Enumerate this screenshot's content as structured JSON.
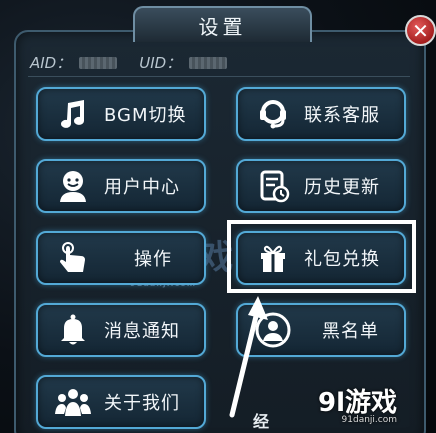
{
  "dialog": {
    "title": "设置",
    "close_glyph": "✕"
  },
  "ids": {
    "aid_label": "AID：",
    "uid_label": "UID："
  },
  "buttons": [
    {
      "label": "BGM切换",
      "icon": "music-note-icon"
    },
    {
      "label": "联系客服",
      "icon": "headset-icon"
    },
    {
      "label": "用户中心",
      "icon": "user-icon"
    },
    {
      "label": "历史更新",
      "icon": "history-doc-icon"
    },
    {
      "label": "操作",
      "icon": "hand-tap-icon"
    },
    {
      "label": "礼包兑换",
      "icon": "gift-icon"
    },
    {
      "label": "消息通知",
      "icon": "bell-icon"
    },
    {
      "label": "黑名单",
      "icon": "blocked-user-icon"
    },
    {
      "label": "关于我们",
      "icon": "group-icon"
    }
  ],
  "watermark": {
    "text": "9l游戏",
    "sub": "91danji.com"
  },
  "brand": {
    "text": "9l游戏",
    "sub": "91danji.com"
  },
  "partial_text": "经",
  "colors": {
    "button_border": "#53a9d6",
    "close_red": "#a51f1f",
    "highlight": "#ffffff"
  }
}
